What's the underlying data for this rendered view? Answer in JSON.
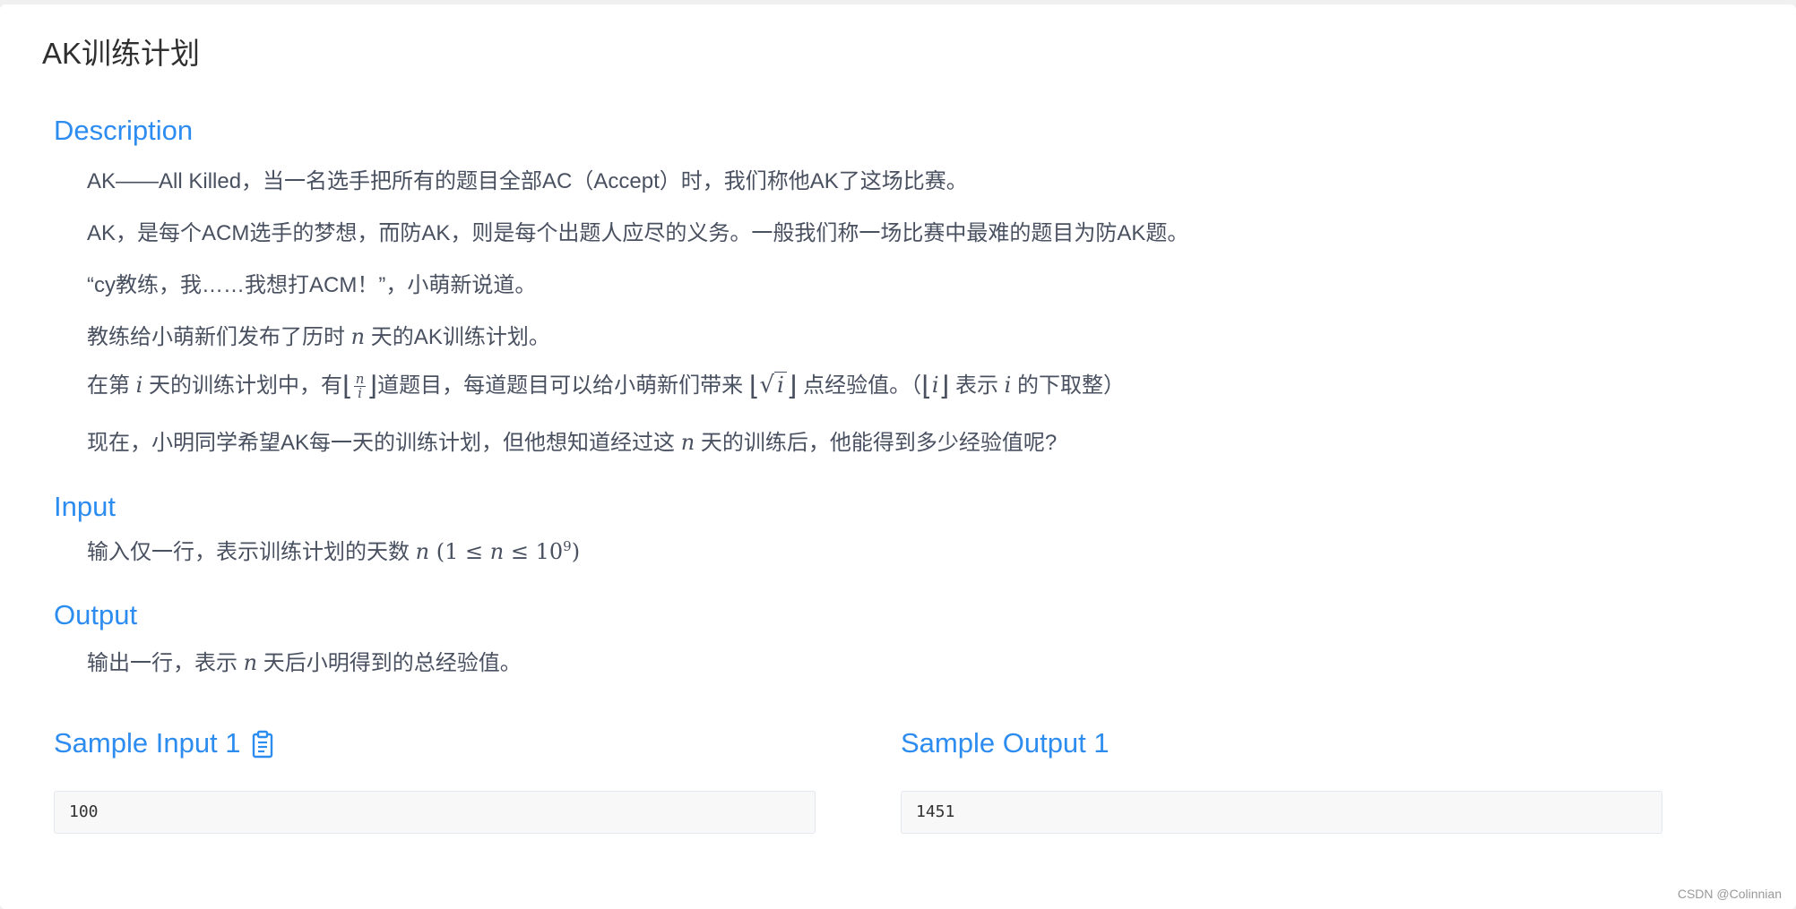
{
  "problem": {
    "title": "AK训练计划"
  },
  "description": {
    "heading": "Description",
    "p1": "AK——All Killed，当一名选手把所有的题目全部AC（Accept）时，我们称他AK了这场比赛。",
    "p2": "AK，是每个ACM选手的梦想，而防AK，则是每个出题人应尽的义务。一般我们称一场比赛中最难的题目为防AK题。",
    "p3": "“cy教练，我……我想打ACM！”，小萌新说道。",
    "p4": {
      "a": "教练给小萌新们发布了历时 ",
      "var": "n",
      "b": " 天的AK训练计划。"
    },
    "p5": {
      "a": "在第 ",
      "i": "i",
      "b": " 天的训练计划中，有",
      "frac_num": "n",
      "frac_den": "i",
      "c": "道题目，每道题目可以给小萌新们带来 ",
      "sqrt_arg": "i",
      "d": " 点经验值。（",
      "floor_arg": "i",
      "e": " 表示 ",
      "i2": "i",
      "f": " 的下取整）"
    },
    "p6": {
      "a": "现在，小明同学希望AK每一天的训练计划，但他想知道经过这 ",
      "var": "n",
      "b": " 天的训练后，他能得到多少经验值呢?"
    }
  },
  "input": {
    "heading": "Input",
    "text": "输入仅一行，表示训练计划的天数 ",
    "var": "n",
    "constraint_open": " (1 ≤ ",
    "constraint_var": "n",
    "constraint_mid": " ≤ 10",
    "constraint_exp": "9",
    "constraint_close": ")"
  },
  "output": {
    "heading": "Output",
    "a": "输出一行，表示 ",
    "var": "n",
    "b": " 天后小明得到的总经验值。"
  },
  "samples": {
    "input_title": "Sample Input 1",
    "input_value": "100",
    "output_title": "Sample Output 1",
    "output_value": "1451",
    "copy_icon": "clipboard-icon"
  },
  "watermark": "CSDN @Colinnian",
  "colors": {
    "accent": "#2d8cf0",
    "text": "#495060",
    "sample_bg": "#f8f8f9"
  }
}
